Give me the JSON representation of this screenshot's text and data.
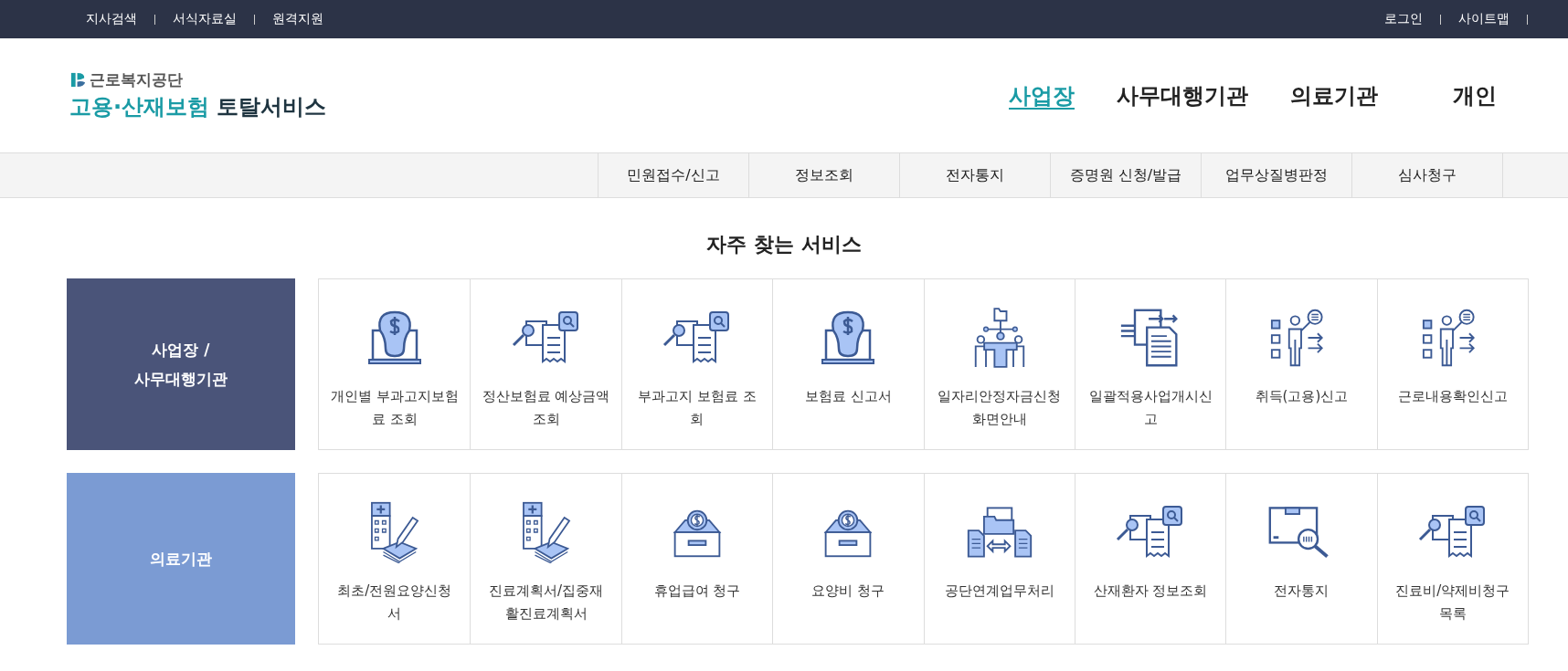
{
  "top_bar": {
    "left_links": [
      "지사검색",
      "서식자료실",
      "원격지원"
    ],
    "right_links": [
      "로그인",
      "사이트맵"
    ]
  },
  "logo": {
    "org": "근로복지공단",
    "title_accent": "고용·산재보험",
    "title_rest": "토탈서비스"
  },
  "main_nav": [
    {
      "label": "사업장",
      "selected": true
    },
    {
      "label": "사무대행기관",
      "selected": false
    },
    {
      "label": "의료기관",
      "selected": false
    },
    {
      "label": "개인",
      "selected": false
    }
  ],
  "sub_nav": [
    "민원접수/신고",
    "정보조회",
    "전자통지",
    "증명원 신청/발급",
    "업무상질병판정",
    "심사청구"
  ],
  "section_title": "자주 찾는 서비스",
  "groups": [
    {
      "title": "사업장 /\n사무대행기관",
      "color": "#4a5479",
      "services": [
        {
          "kind": "bulb",
          "label": "개인별 부과고지보험료 조회"
        },
        {
          "kind": "docsearch",
          "label": "정산보험료 예상금액 조회"
        },
        {
          "kind": "docsearch",
          "label": "부과고지 보험료 조회"
        },
        {
          "kind": "bulb",
          "label": "보험료 신고서"
        },
        {
          "kind": "org",
          "label": "일자리안정자금신청화면안내"
        },
        {
          "kind": "transfer",
          "label": "일괄적용사업개시신고"
        },
        {
          "kind": "person",
          "label": "취득(고용)신고"
        },
        {
          "kind": "person",
          "label": "근로내용확인신고"
        }
      ]
    },
    {
      "title": "의료기관",
      "color": "#7b9bd3",
      "services": [
        {
          "kind": "hospital",
          "label": "최초/전원요양신청서"
        },
        {
          "kind": "hospital",
          "label": "진료계획서/집중재활진료계획서"
        },
        {
          "kind": "coinbox",
          "label": "휴업급여 청구"
        },
        {
          "kind": "coinbox",
          "label": "요양비 청구"
        },
        {
          "kind": "exchange",
          "label": "공단연계업무처리"
        },
        {
          "kind": "docsearch",
          "label": "산재환자 정보조회"
        },
        {
          "kind": "boxsearch",
          "label": "전자통지"
        },
        {
          "kind": "docsearch",
          "label": "진료비/약제비청구목록"
        }
      ]
    }
  ]
}
